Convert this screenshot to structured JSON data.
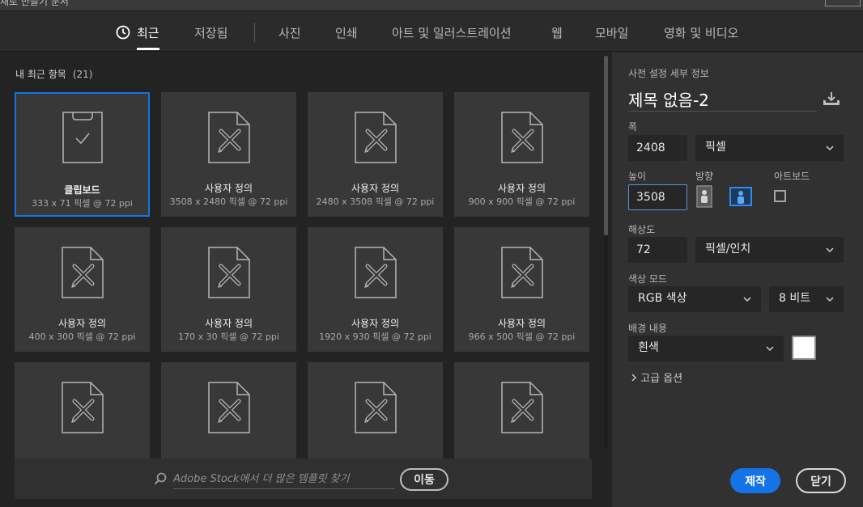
{
  "window": {
    "title": "새로 만들기 문서"
  },
  "tabs": [
    {
      "label": "최근",
      "active": true
    },
    {
      "label": "저장됨"
    },
    {
      "label": "사진"
    },
    {
      "label": "인쇄"
    },
    {
      "label": "아트 및 일러스트레이션"
    },
    {
      "label": "웹"
    },
    {
      "label": "모바일"
    },
    {
      "label": "영화 및 비디오"
    }
  ],
  "recent": {
    "title": "내 최근 항목",
    "count": "(21)",
    "items": [
      {
        "name": "클립보드",
        "size": "333 x 71 픽셀 @ 72 ppi",
        "icon": "clipboard-icon",
        "selected": true
      },
      {
        "name": "사용자 정의",
        "size": "3508 x 2480 픽셀 @ 72 ppi",
        "icon": "custom-document-icon"
      },
      {
        "name": "사용자 정의",
        "size": "2480 x 3508 픽셀 @ 72 ppi",
        "icon": "custom-document-icon"
      },
      {
        "name": "사용자 정의",
        "size": "900 x 900 픽셀 @ 72 ppi",
        "icon": "custom-document-icon"
      },
      {
        "name": "사용자 정의",
        "size": "400 x 300 픽셀 @ 72 ppi",
        "icon": "custom-document-icon"
      },
      {
        "name": "사용자 정의",
        "size": "170 x 30 픽셀 @ 72 ppi",
        "icon": "custom-document-icon"
      },
      {
        "name": "사용자 정의",
        "size": "1920 x 930 픽셀 @ 72 ppi",
        "icon": "custom-document-icon"
      },
      {
        "name": "사용자 정의",
        "size": "966 x 500 픽셀 @ 72 ppi",
        "icon": "custom-document-icon"
      },
      {
        "name": "",
        "size": "",
        "icon": "custom-document-icon"
      },
      {
        "name": "",
        "size": "",
        "icon": "custom-document-icon"
      },
      {
        "name": "",
        "size": "",
        "icon": "custom-document-icon"
      },
      {
        "name": "",
        "size": "",
        "icon": "custom-document-icon"
      }
    ]
  },
  "stock": {
    "placeholder": "Adobe Stock에서 더 많은 템플릿 찾기",
    "go_label": "이동"
  },
  "preset": {
    "heading": "사전 설정 세부 정보",
    "name": "제목 없음-2",
    "width_label": "폭",
    "width": "2408",
    "width_unit": "픽셀",
    "height_label": "높이",
    "height": "3508",
    "orientation_label": "방향",
    "orientation": "landscape",
    "artboard_label": "아트보드",
    "artboard_checked": false,
    "resolution_label": "해상도",
    "resolution": "72",
    "resolution_unit": "픽셀/인치",
    "color_mode_label": "색상 모드",
    "color_mode": "RGB 색상",
    "bit_depth": "8 비트",
    "background_label": "배경 내용",
    "background": "흰색",
    "background_color": "#ffffff",
    "advanced_label": "고급 옵션"
  },
  "buttons": {
    "create": "제작",
    "close": "닫기"
  },
  "colors": {
    "accent": "#1473e6",
    "panel": "#313131",
    "card": "#383838"
  }
}
